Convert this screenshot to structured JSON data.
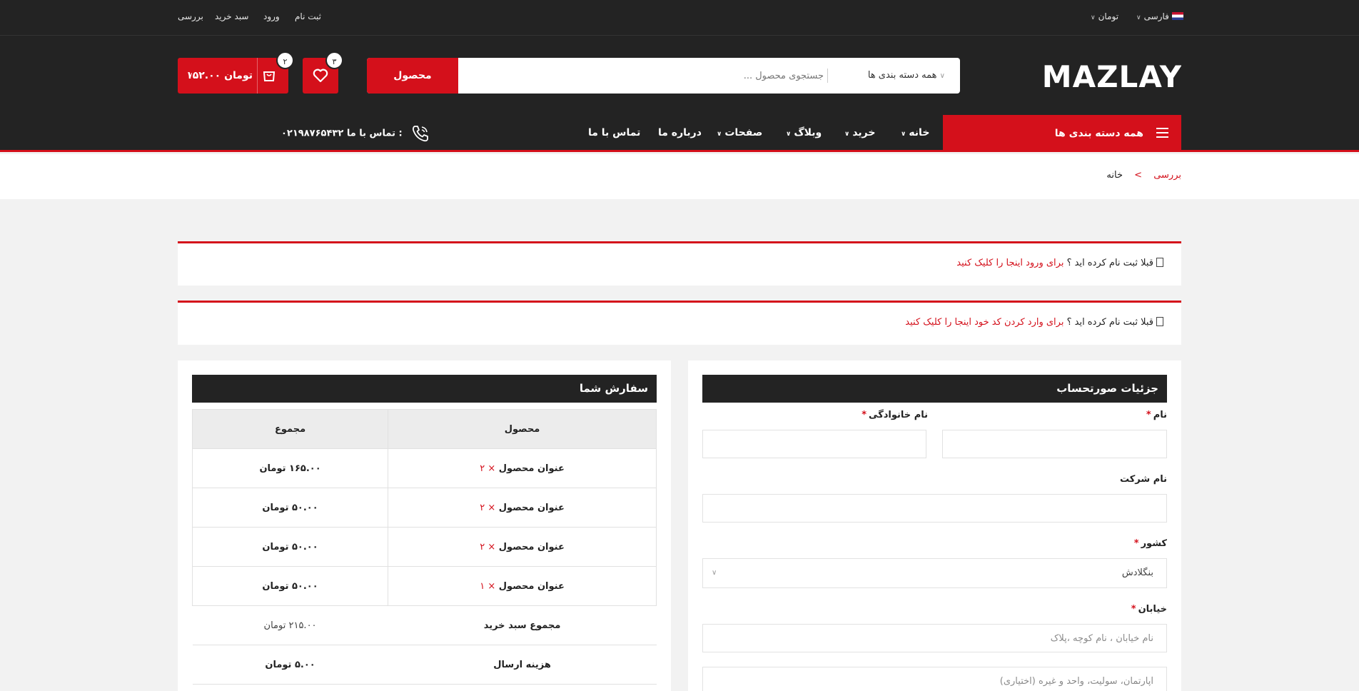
{
  "topbar": {
    "language": "فارسی",
    "currency": "تومان",
    "links": [
      "ثبت نام",
      "ورود",
      "سبد خرید",
      "بررسی"
    ]
  },
  "header": {
    "logo_text": "MAZLAY",
    "search_placeholder": "جستجوی محصول ...",
    "category_select": "همه دسته بندی ها",
    "search_button": "محصول",
    "wishlist_count": "۳",
    "cart_count": "۲",
    "cart_total": "۱۵۲.۰۰ تومان"
  },
  "nav": {
    "all_categories": "همه دسته بندی ها",
    "items": [
      "خانه",
      "خرید",
      "وبلاگ",
      "صفحات",
      "درباره ما",
      "تماس با ما"
    ],
    "phone_label": "تماس با ما :",
    "phone_number": "۰۲۱۹۸۷۶۵۴۳۲"
  },
  "breadcrumb": {
    "home": "خانه",
    "separator": ">",
    "current": "بررسی"
  },
  "notices": [
    {
      "text": "قبلا ثبت نام کرده اید ؟",
      "link": "برای ورود اینجا را کلیک کنید"
    },
    {
      "text": "قبلا ثبت نام کرده اید ؟",
      "link": "برای وارد کردن کد خود اینجا را کلیک کنید"
    }
  ],
  "billing": {
    "title": "جزئیات صورتحساب",
    "first_name_label": "نام",
    "last_name_label": "نام خانوادگی",
    "company_label": "نام شرکت",
    "country_label": "کشور",
    "country_value": "بنگلادش",
    "street_label": "خیابان",
    "street_placeholder": "نام خیابان ، نام کوچه ،پلاک",
    "apartment_placeholder": "آپارتمان، سولیت، واحد و غیره (اختیاری)",
    "required_mark": "*"
  },
  "order": {
    "title": "سفارش شما",
    "col_product": "محصول",
    "col_total": "مجموع",
    "rows": [
      {
        "product": "عنوان محصول",
        "qty": "× ۲",
        "total": "۱۶۵.۰۰ تومان"
      },
      {
        "product": "عنوان محصول",
        "qty": "× ۲",
        "total": "۵۰.۰۰ تومان"
      },
      {
        "product": "عنوان محصول",
        "qty": "× ۲",
        "total": "۵۰.۰۰ تومان"
      },
      {
        "product": "عنوان محصول",
        "qty": "× ۱",
        "total": "۵۰.۰۰ تومان"
      }
    ],
    "subtotal_label": "مجموع سبد خرید",
    "subtotal_value": "۲۱۵.۰۰ تومان",
    "shipping_label": "هزینه ارسال",
    "shipping_value": "۵.۰۰ تومان"
  },
  "colors": {
    "accent": "#d4101b",
    "dark": "#232323",
    "bg": "#f2f2f2"
  }
}
